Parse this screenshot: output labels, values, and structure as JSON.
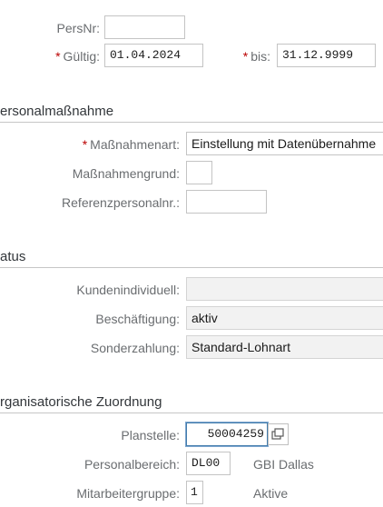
{
  "header": {
    "persnr_label": "PersNr:",
    "persnr_value": "",
    "gueltig_label": "Gültig:",
    "gueltig_value": "01.04.2024",
    "bis_label": "bis:",
    "bis_value": "31.12.9999",
    "required_marker": "*"
  },
  "groups": {
    "personalmassnahme": {
      "title": "ersonalmaßnahme",
      "massnahmenart_label": "Maßnahmenart:",
      "massnahmenart_value": "Einstellung mit Datenübernahme",
      "massnahmengrund_label": "Maßnahmengrund:",
      "massnahmengrund_value": "",
      "referenz_label": "Referenzpersonalnr.:",
      "referenz_value": ""
    },
    "status": {
      "title": "atus",
      "kundenindividuell_label": "Kundenindividuell:",
      "kundenindividuell_value": "",
      "beschaeftigung_label": "Beschäftigung:",
      "beschaeftigung_value": "aktiv",
      "sonderzahlung_label": "Sonderzahlung:",
      "sonderzahlung_value": "Standard-Lohnart"
    },
    "org": {
      "title": "rganisatorische Zuordnung",
      "planstelle_label": "Planstelle:",
      "planstelle_value": "50004259",
      "personalbereich_label": "Personalbereich:",
      "personalbereich_value": "DL00",
      "personalbereich_text": "GBI Dallas",
      "mitarbeitergruppe_label": "Mitarbeitergruppe:",
      "mitarbeitergruppe_value": "1",
      "mitarbeitergruppe_text": "Aktive"
    }
  },
  "icons": {
    "f4_help": "value-help-icon"
  },
  "colors": {
    "required": "#bb0000",
    "focus_border": "#427cac"
  }
}
